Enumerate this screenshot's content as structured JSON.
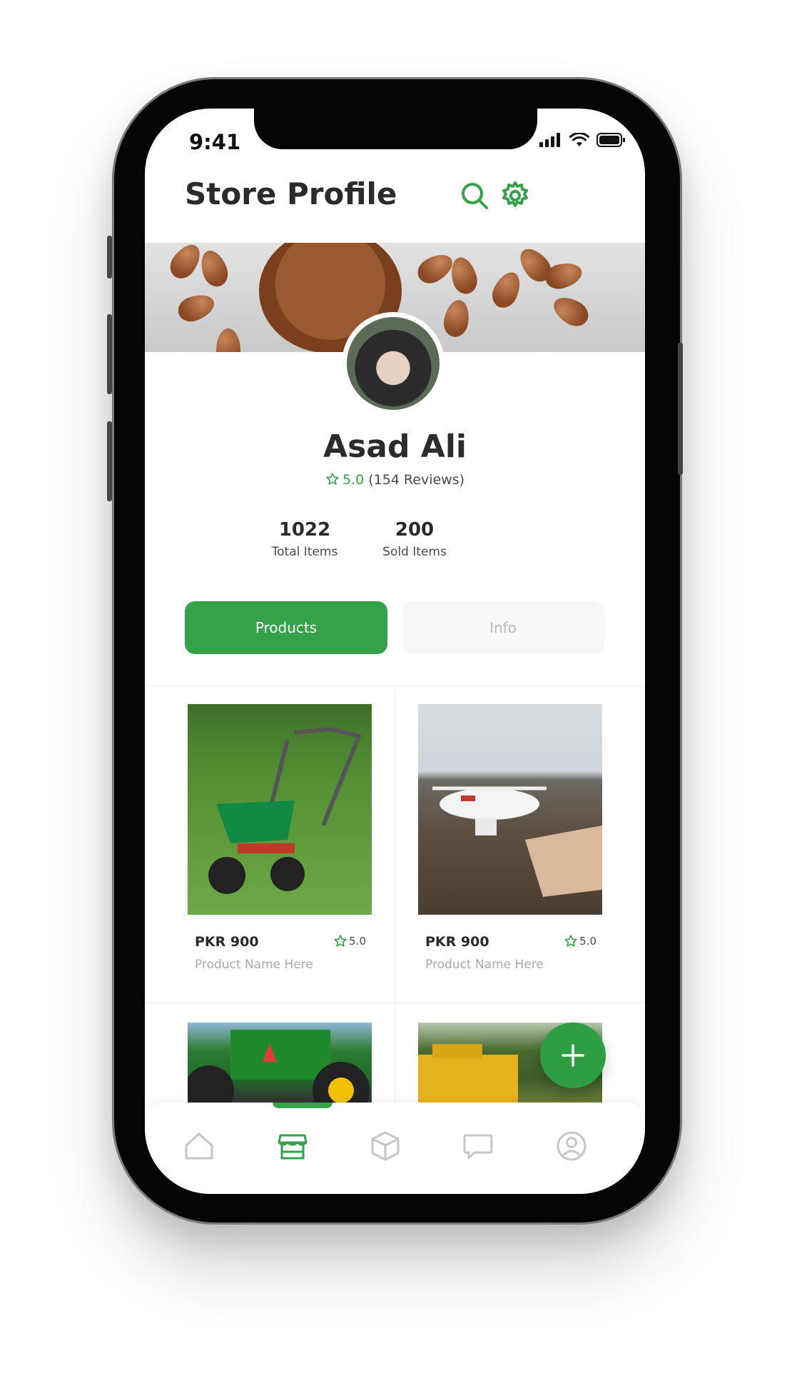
{
  "status_bar": {
    "time": "9:41"
  },
  "header": {
    "title": "Store Profile",
    "search_icon": "search-icon",
    "settings_icon": "gear-icon"
  },
  "profile": {
    "name": "Asad Ali",
    "rating": "5.0",
    "reviews": "(154 Reviews)",
    "stats": [
      {
        "value": "1022",
        "label": "Total Items"
      },
      {
        "value": "200",
        "label": "Sold Items"
      }
    ]
  },
  "tabs": [
    {
      "label": "Products",
      "active": true
    },
    {
      "label": "Info",
      "active": false
    }
  ],
  "products": [
    {
      "price": "PKR 900",
      "rating": "5.0",
      "name": "Product Name Here"
    },
    {
      "price": "PKR 900",
      "rating": "5.0",
      "name": "Product Name Here"
    }
  ],
  "fab": {
    "icon": "plus-icon"
  },
  "bottom_nav": {
    "items": [
      {
        "icon": "home-icon",
        "active": false
      },
      {
        "icon": "store-icon",
        "active": true
      },
      {
        "icon": "box-icon",
        "active": false
      },
      {
        "icon": "chat-icon",
        "active": false
      },
      {
        "icon": "profile-icon",
        "active": false
      }
    ]
  },
  "colors": {
    "accent": "#35a148",
    "text": "#2b2b2b",
    "muted": "#a8a8a8"
  }
}
